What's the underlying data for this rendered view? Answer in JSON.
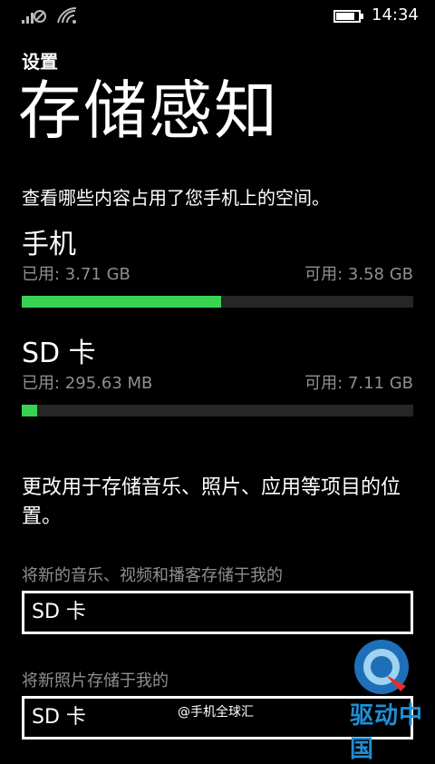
{
  "status_bar": {
    "time": "14:34",
    "icons": [
      "signal-icon",
      "wifi-icon",
      "battery-icon"
    ]
  },
  "header": {
    "section": "设置",
    "title": "存储感知"
  },
  "description": "查看哪些内容占用了您手机上的空间。",
  "storage": [
    {
      "name": "手机",
      "used": "已用: 3.71 GB",
      "available": "可用: 3.58 GB",
      "fill_fraction": 0.51
    },
    {
      "name": "SD 卡",
      "used": "已用: 295.63 MB",
      "available": "可用: 7.11 GB",
      "fill_fraction": 0.04
    }
  ],
  "change_location_text": "更改用于存储音乐、照片、应用等项目的位置。",
  "settings": [
    {
      "label": "将新的音乐、视频和播客存储于我的",
      "value": "SD 卡"
    },
    {
      "label": "将新照片存储于我的",
      "value": "SD 卡"
    }
  ],
  "watermark": "@手机全球汇",
  "logo_text": "驱动中国",
  "colors": {
    "accent": "#39d353",
    "background": "#000000",
    "secondary_text": "#8f8f8f"
  }
}
